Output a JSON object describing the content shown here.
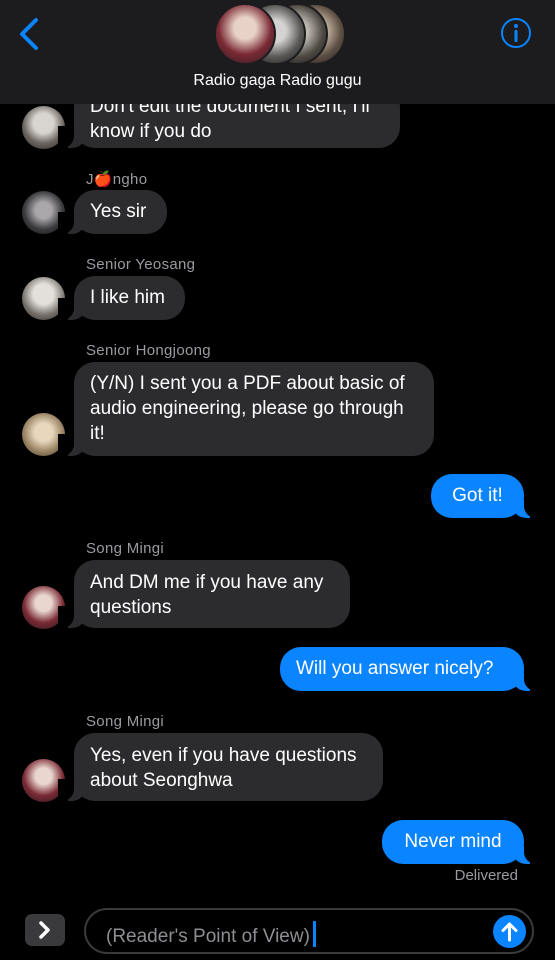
{
  "header": {
    "title": "Radio gaga Radio gugu"
  },
  "messages": [
    {
      "sender": "",
      "text": "Don't edit the document I sent, I'll know if you do",
      "line1": "Don't edit the document I sent, I'll",
      "line2": "know if you do"
    },
    {
      "sender": "J🍎ngho",
      "text": "Yes sir"
    },
    {
      "sender": "Senior Yeosang",
      "text": "I like him"
    },
    {
      "sender": "Senior Hongjoong",
      "text": "(Y/N) I sent you a PDF about basic of audio engineering, please go through it!"
    },
    {
      "sender": "",
      "text": "Got it!"
    },
    {
      "sender": "Song Mingi",
      "text": "And DM me if you have any questions"
    },
    {
      "sender": "",
      "text": "Will you answer nicely?"
    },
    {
      "sender": "Song Mingi",
      "text": "Yes, even if you have questions about Seonghwa"
    },
    {
      "sender": "",
      "text": "Never mind"
    }
  ],
  "status": {
    "delivered": "Delivered"
  },
  "composer": {
    "text": "(Reader's Point of View)"
  },
  "colors": {
    "accent": "#0a84ff",
    "incoming_bubble": "#2c2c2e",
    "header_bg": "#1c1c1e"
  }
}
